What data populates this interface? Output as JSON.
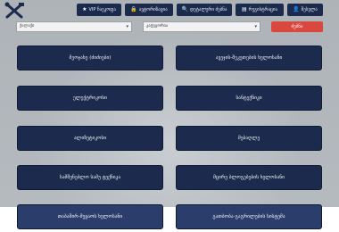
{
  "header": {
    "nav": [
      {
        "icon": "star-icon",
        "glyph": "★",
        "label": "VIP ჩაეკოფა"
      },
      {
        "icon": "lock-icon",
        "glyph": "🔒",
        "label": "ავტორიზაცია"
      },
      {
        "icon": "search-icon",
        "glyph": "🔍",
        "label": "დეტალური ძებნა"
      },
      {
        "icon": "list-icon",
        "glyph": "▤",
        "label": "რეგისტრაცია"
      },
      {
        "icon": "user-icon",
        "glyph": "👤",
        "label": "შესვლა"
      }
    ]
  },
  "filters": {
    "city": "ქალაქი",
    "category": "კატეგორია",
    "search_label": "ძებნა"
  },
  "categories": [
    "მეოჯახე (ძიძიები)",
    "ავეჯის-შეკეთების ხელოსანი",
    "ელექტრიკოსი",
    "სანტექნიკი",
    "ალიზეტიკოსი",
    "მებაღლე",
    "სამშენებლო სამუ ტექნიკა",
    "მცირე ბლოგებების ხელოსანი",
    "თაბაშირ-მუყაოს ხელოსანი",
    "გათბობა-გაგრილების სისტემა"
  ]
}
